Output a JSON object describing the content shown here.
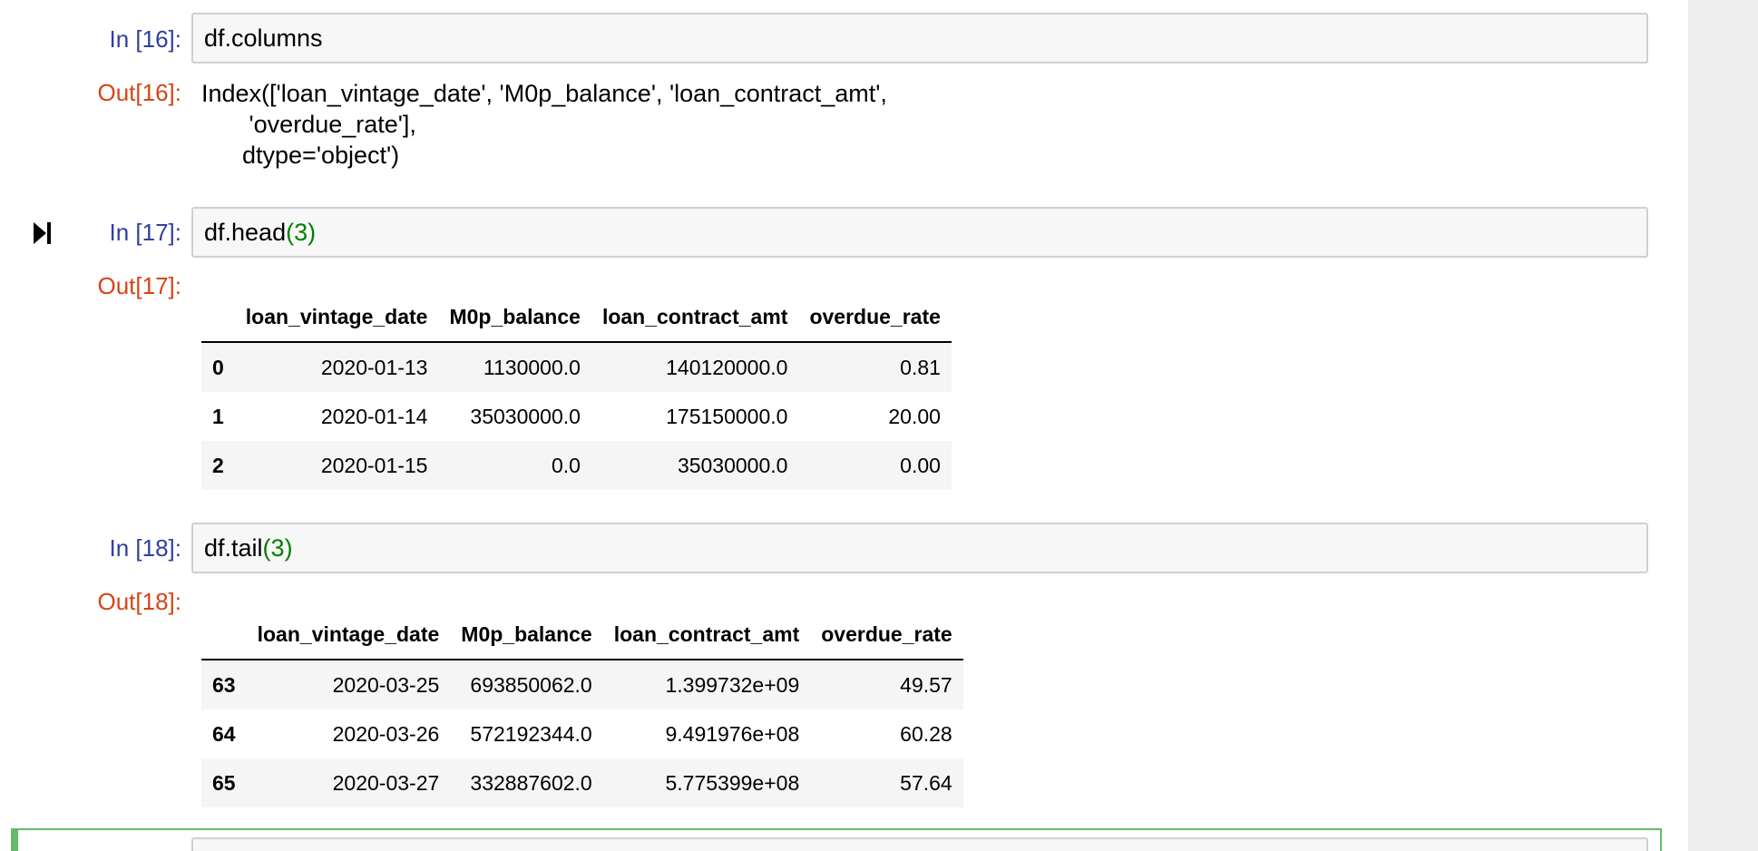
{
  "cells": [
    {
      "in_prompt": "In [16]:",
      "code": "df.columns",
      "out_prompt": "Out[16]:",
      "output_text": "Index(['loan_vintage_date', 'M0p_balance', 'loan_contract_amt',\n       'overdue_rate'],\n      dtype='object')"
    },
    {
      "in_prompt": "In [17]:",
      "code_name": "df.head",
      "code_paren_open": "(",
      "code_arg": "3",
      "code_paren_close": ")",
      "out_prompt": "Out[17]:",
      "table": {
        "columns": [
          "",
          "loan_vintage_date",
          "M0p_balance",
          "loan_contract_amt",
          "overdue_rate"
        ],
        "rows": [
          [
            "0",
            "2020-01-13",
            "1130000.0",
            "140120000.0",
            "0.81"
          ],
          [
            "1",
            "2020-01-14",
            "35030000.0",
            "175150000.0",
            "20.00"
          ],
          [
            "2",
            "2020-01-15",
            "0.0",
            "35030000.0",
            "0.00"
          ]
        ]
      }
    },
    {
      "in_prompt": "In [18]:",
      "code_name": "df.tail",
      "code_paren_open": "(",
      "code_arg": "3",
      "code_paren_close": ")",
      "out_prompt": "Out[18]:",
      "table": {
        "columns": [
          "",
          "loan_vintage_date",
          "M0p_balance",
          "loan_contract_amt",
          "overdue_rate"
        ],
        "rows": [
          [
            "63",
            "2020-03-25",
            "693850062.0",
            "1.399732e+09",
            "49.57"
          ],
          [
            "64",
            "2020-03-26",
            "572192344.0",
            "9.491976e+08",
            "60.28"
          ],
          [
            "65",
            "2020-03-27",
            "332887602.0",
            "5.775399e+08",
            "57.64"
          ]
        ]
      }
    }
  ],
  "icons": {
    "run_indicator": "step-forward-icon"
  },
  "colors": {
    "in_prompt": "#303f9f",
    "out_prompt": "#d84315",
    "number_literal": "#008000",
    "active_cell_border": "#66bb6a"
  }
}
